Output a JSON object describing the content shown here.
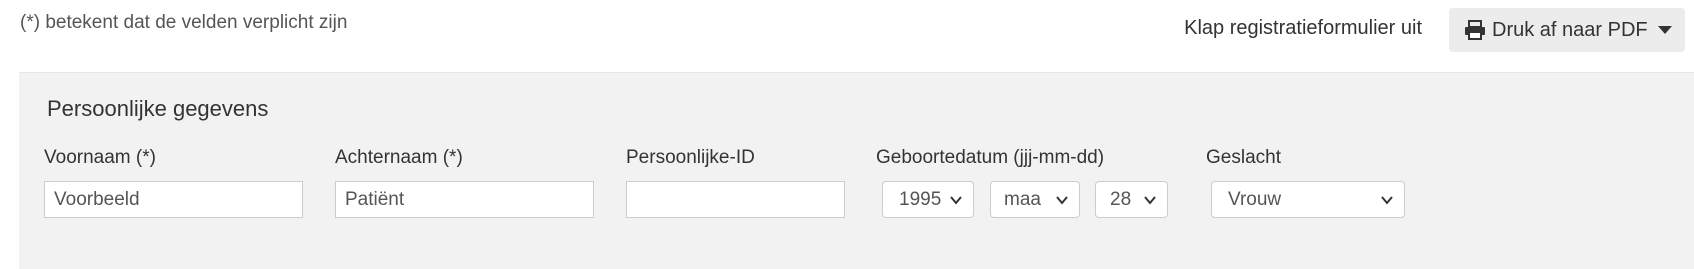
{
  "header": {
    "required_note": "(*) betekent dat de velden verplicht zijn",
    "collapse_label": "Klap registratieformulier uit",
    "pdf_button_label": "Druk af naar PDF"
  },
  "section": {
    "title": "Persoonlijke gegevens"
  },
  "fields": {
    "first_name": {
      "label": "Voornaam (*)",
      "value": "Voorbeeld"
    },
    "last_name": {
      "label": "Achternaam (*)",
      "value": "Patiënt"
    },
    "personal_id": {
      "label": "Persoonlijke-ID",
      "value": ""
    },
    "birthdate": {
      "label": "Geboortedatum (jjj-mm-dd)",
      "year": "1995",
      "month": "maa",
      "day": "28"
    },
    "gender": {
      "label": "Geslacht",
      "value": "Vrouw"
    }
  },
  "icons": {
    "printer": "printer-icon",
    "caret": "caret-down-icon",
    "chevron": "chevron-down-icon"
  }
}
